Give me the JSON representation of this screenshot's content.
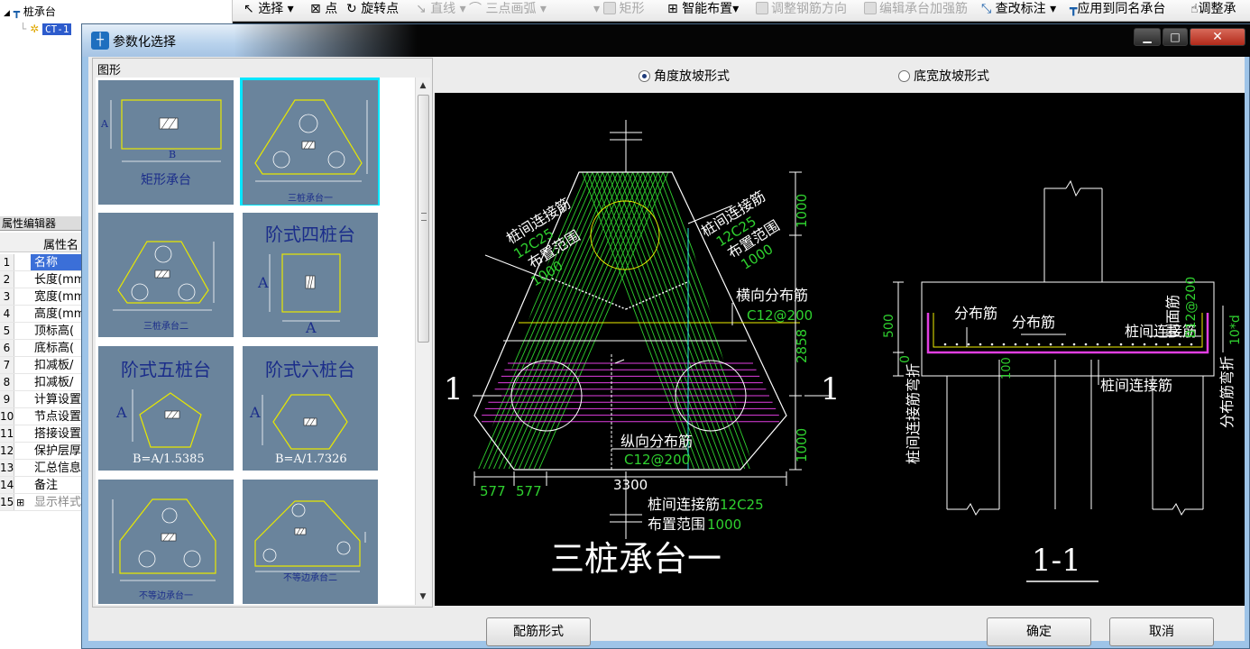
{
  "tree": {
    "root_label": "桩承台",
    "child_label": "CT-1"
  },
  "property_editor": {
    "title": "属性编辑器",
    "column_header": "属性名",
    "rows": [
      {
        "num": "1",
        "name": "名称"
      },
      {
        "num": "2",
        "name": "长度(mm"
      },
      {
        "num": "3",
        "name": "宽度(mm"
      },
      {
        "num": "4",
        "name": "高度(mm"
      },
      {
        "num": "5",
        "name": "顶标高("
      },
      {
        "num": "6",
        "name": "底标高("
      },
      {
        "num": "7",
        "name": "扣减板/"
      },
      {
        "num": "8",
        "name": "扣减板/"
      },
      {
        "num": "9",
        "name": "计算设置"
      },
      {
        "num": "10",
        "name": "节点设置"
      },
      {
        "num": "11",
        "name": "搭接设置"
      },
      {
        "num": "12",
        "name": "保护层厚"
      },
      {
        "num": "13",
        "name": "汇总信息"
      },
      {
        "num": "14",
        "name": "备注"
      },
      {
        "num": "15",
        "name": "显示样式"
      }
    ]
  },
  "toolbar": {
    "select": "选择",
    "point": "点",
    "rotate_point": "旋转点",
    "line": "直线",
    "three_point_arc": "三点画弧",
    "rectangle": "矩形",
    "smart_layout": "智能布置",
    "adjust_rebar_direction": "调整钢筋方向",
    "edit_reinforcement": "编辑承台加强筋",
    "edit_annotation": "查改标注",
    "apply_same_name": "应用到同名承台",
    "adjust_cap": "调整承"
  },
  "dialog": {
    "title": "参数化选择",
    "group_label": "图形",
    "radio_angle": "角度放坡形式",
    "radio_width": "底宽放坡形式",
    "btn_rebar_form": "配筋形式",
    "btn_ok": "确定",
    "btn_cancel": "取消",
    "win_min": "▁",
    "win_max": "□",
    "win_close": "✕"
  },
  "thumbnails": [
    {
      "caption": "矩形承台",
      "dim_a": "A",
      "dim_b": "B"
    },
    {
      "caption": "三桩承台一"
    },
    {
      "caption": "三桩承台二"
    },
    {
      "caption": "阶式四桩台",
      "dim_a": "A",
      "dim_b": "A"
    },
    {
      "caption": "阶式五桩台",
      "dim_a": "A",
      "formula": "B=A/1.5385"
    },
    {
      "caption": "阶式六桩台",
      "dim_a": "A",
      "formula": "B=A/1.7326"
    },
    {
      "caption": "不等边承台一"
    },
    {
      "caption": "不等边承台二"
    }
  ],
  "drawing": {
    "title": "三桩承台一",
    "section_mark": "1",
    "section_title": "1-1",
    "labels": {
      "pile_conn_left": "桩间连接筋",
      "pile_conn_left_spec": "12C25",
      "range_left": "布置范围",
      "range_left_val": "1000",
      "pile_conn_right": "桩间连接筋",
      "pile_conn_right_spec": "12C25",
      "range_right": "布置范围",
      "range_right_val": "1000",
      "transverse": "横向分布筋",
      "transverse_spec": "C12@200",
      "longitudinal": "纵向分布筋",
      "longitudinal_spec": "C12@200",
      "pile_conn_bottom": "桩间连接筋",
      "pile_conn_bottom_spec": "12C25",
      "range_bottom": "布置范围",
      "range_bottom_val": "1000",
      "dim_top": "1000",
      "dim_mid": "2858",
      "dim_bot": "1000",
      "dim_width": "3300",
      "dim_577a": "577",
      "dim_577b": "577",
      "sec_distribution1": "分布筋",
      "sec_distribution2": "分布筋",
      "sec_pile_conn": "桩间连接筋",
      "sec_pile_conn_bottom": "桩间连接筋",
      "sec_pile_conn_bend": "桩间连接筋弯折",
      "sec_side_rebar": "侧面筋",
      "sec_side_spec": "B12@200",
      "sec_dist_bend": "分布筋弯折",
      "sec_10d": "10*d",
      "sec_500": "500",
      "sec_0": "0",
      "sec_100": "100"
    }
  },
  "colors": {
    "green": "#2fd12f",
    "magenta": "#e23ee2",
    "yellow": "#f0f000",
    "cyan_select": "#00e6ff",
    "thumb_bg": "#6a849c",
    "thumb_caption": "#1b2d8a"
  }
}
